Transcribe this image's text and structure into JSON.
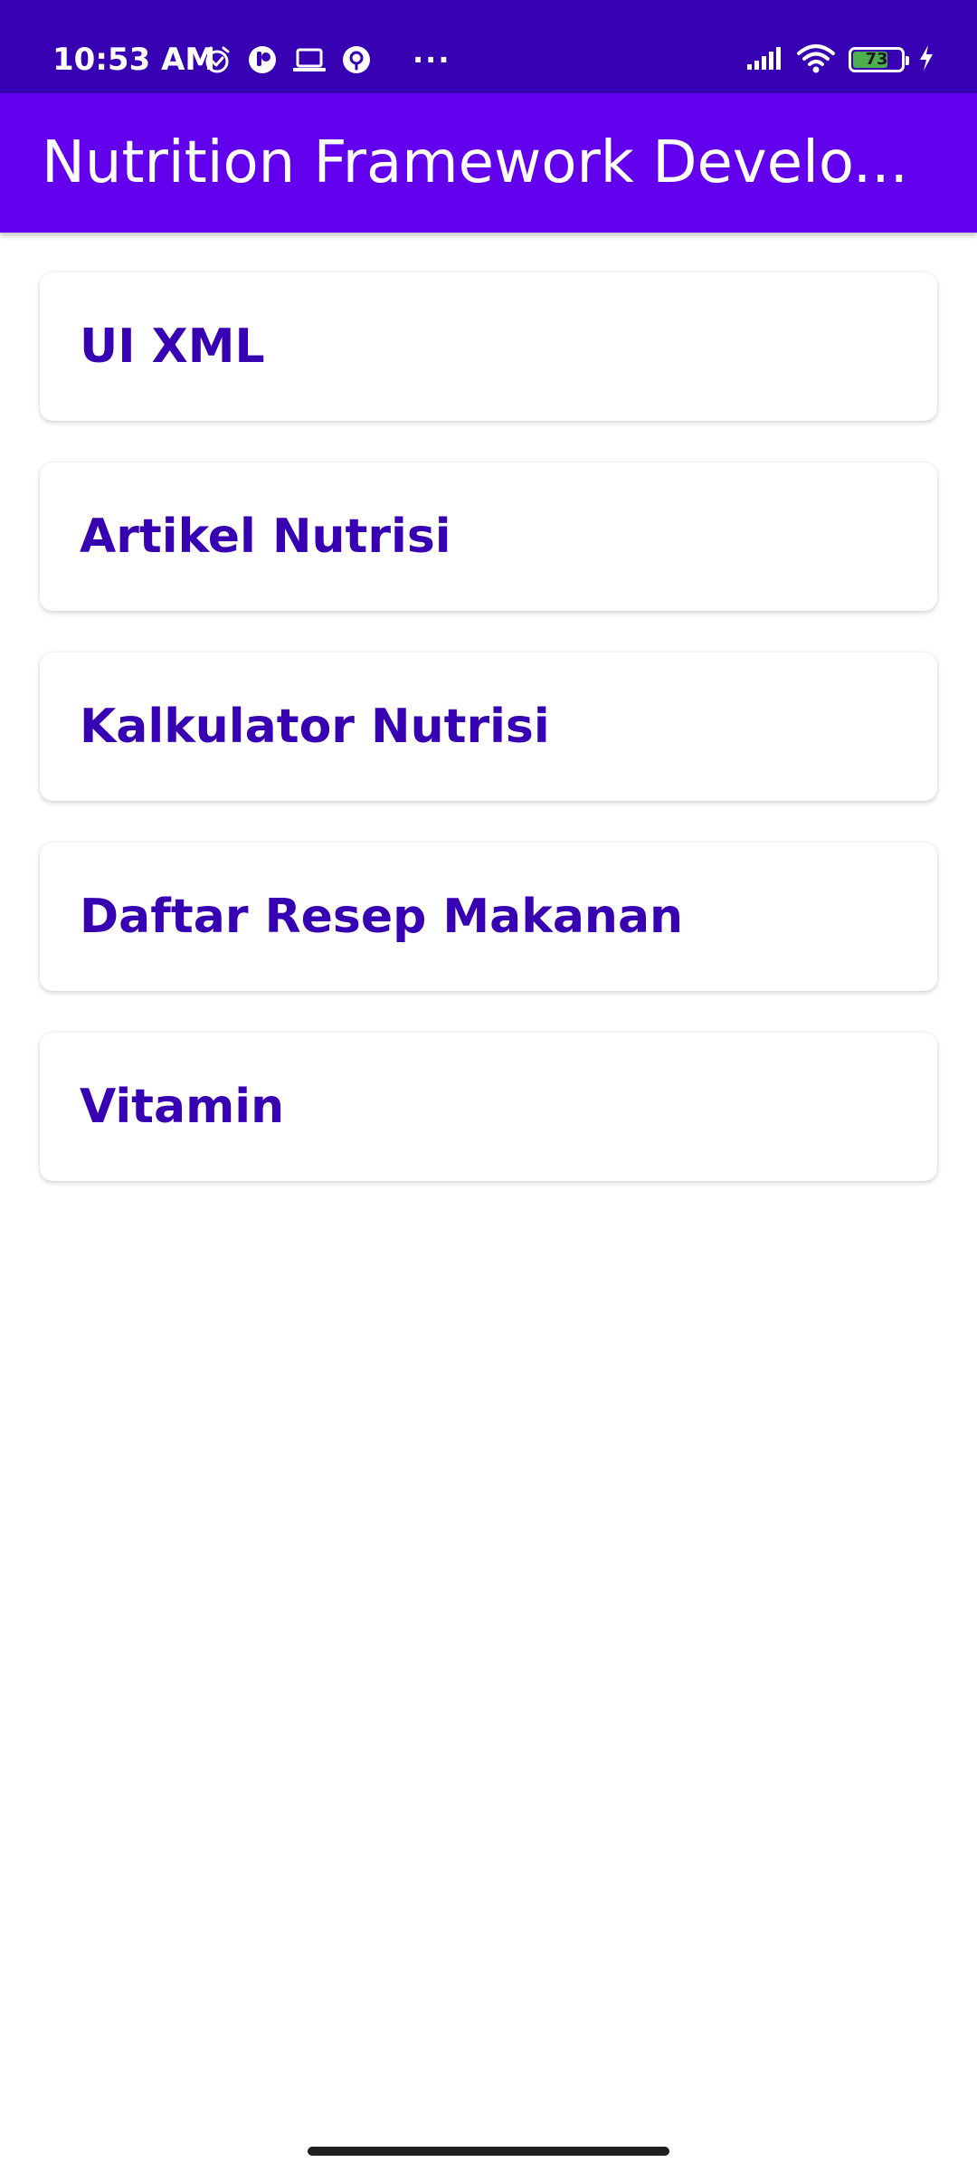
{
  "status_bar": {
    "time": "10:53 AM",
    "more_dots": "···",
    "battery_level": "73",
    "battery_fraction": 0.73,
    "left_icons": [
      "alarm-icon",
      "app-notification-icon",
      "laptop-icon",
      "location-icon"
    ],
    "right_icons": [
      "signal-icon",
      "wifi-icon",
      "battery-icon",
      "charging-icon"
    ]
  },
  "app_bar": {
    "title": "Nutrition Framework Develo..."
  },
  "menu": {
    "items": [
      {
        "label": "UI XML"
      },
      {
        "label": "Artikel Nutrisi"
      },
      {
        "label": "Kalkulator Nutrisi"
      },
      {
        "label": "Daftar Resep Makanan"
      },
      {
        "label": "Vitamin"
      }
    ]
  },
  "colors": {
    "status_bar": "#3700B3",
    "app_bar": "#6200EE",
    "card_text": "#3700B3",
    "battery_fill": "#4CAF50"
  }
}
